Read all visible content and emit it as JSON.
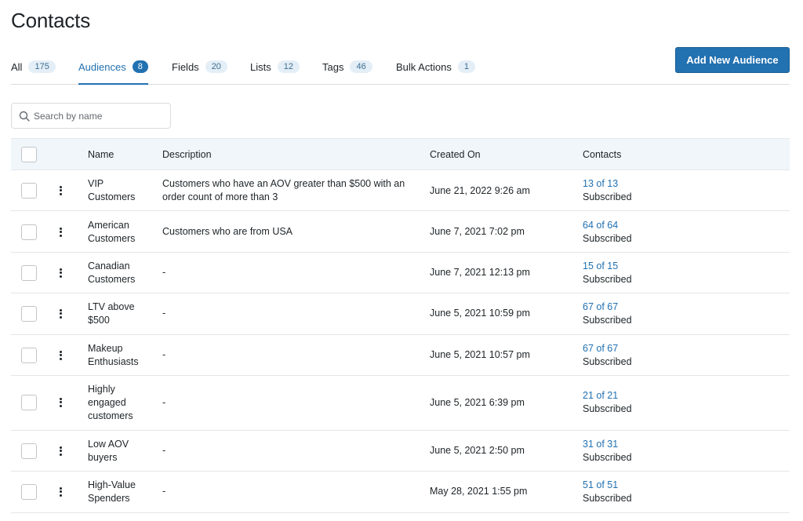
{
  "page": {
    "title": "Contacts"
  },
  "tabs": [
    {
      "label": "All",
      "count": "175"
    },
    {
      "label": "Audiences",
      "count": "8"
    },
    {
      "label": "Fields",
      "count": "20"
    },
    {
      "label": "Lists",
      "count": "12"
    },
    {
      "label": "Tags",
      "count": "46"
    },
    {
      "label": "Bulk Actions",
      "count": "1"
    }
  ],
  "active_tab": "Audiences",
  "toolbar": {
    "add_label": "Add New Audience"
  },
  "search": {
    "placeholder": "Search by name",
    "value": ""
  },
  "table": {
    "headers": {
      "name": "Name",
      "description": "Description",
      "created": "Created On",
      "contacts": "Contacts"
    },
    "rows": [
      {
        "name": "VIP Customers",
        "description": "Customers who have an AOV greater than $500 with an order count of more than 3",
        "created": "June 21, 2022 9:26 am",
        "contacts": "13 of 13",
        "status": "Subscribed"
      },
      {
        "name": "American Customers",
        "description": "Customers who are from USA",
        "created": "June 7, 2021 7:02 pm",
        "contacts": "64 of 64",
        "status": "Subscribed"
      },
      {
        "name": "Canadian Customers",
        "description": "-",
        "created": "June 7, 2021 12:13 pm",
        "contacts": "15 of 15",
        "status": "Subscribed"
      },
      {
        "name": "LTV above $500",
        "description": "-",
        "created": "June 5, 2021 10:59 pm",
        "contacts": "67 of 67",
        "status": "Subscribed"
      },
      {
        "name": "Makeup Enthusiasts",
        "description": "-",
        "created": "June 5, 2021 10:57 pm",
        "contacts": "67 of 67",
        "status": "Subscribed"
      },
      {
        "name": "Highly engaged customers",
        "description": "-",
        "created": "June 5, 2021 6:39 pm",
        "contacts": "21 of 21",
        "status": "Subscribed"
      },
      {
        "name": "Low AOV buyers",
        "description": "-",
        "created": "June 5, 2021 2:50 pm",
        "contacts": "31 of 31",
        "status": "Subscribed"
      },
      {
        "name": "High-Value Spenders",
        "description": "-",
        "created": "May 28, 2021 1:55 pm",
        "contacts": "51 of 51",
        "status": "Subscribed"
      }
    ]
  },
  "colors": {
    "accent": "#2271b1",
    "header_bg": "#f0f6fa",
    "badge_bg": "#e4eef6"
  },
  "icons": {
    "search": "search-icon",
    "row_menu": "more-vertical-icon"
  }
}
